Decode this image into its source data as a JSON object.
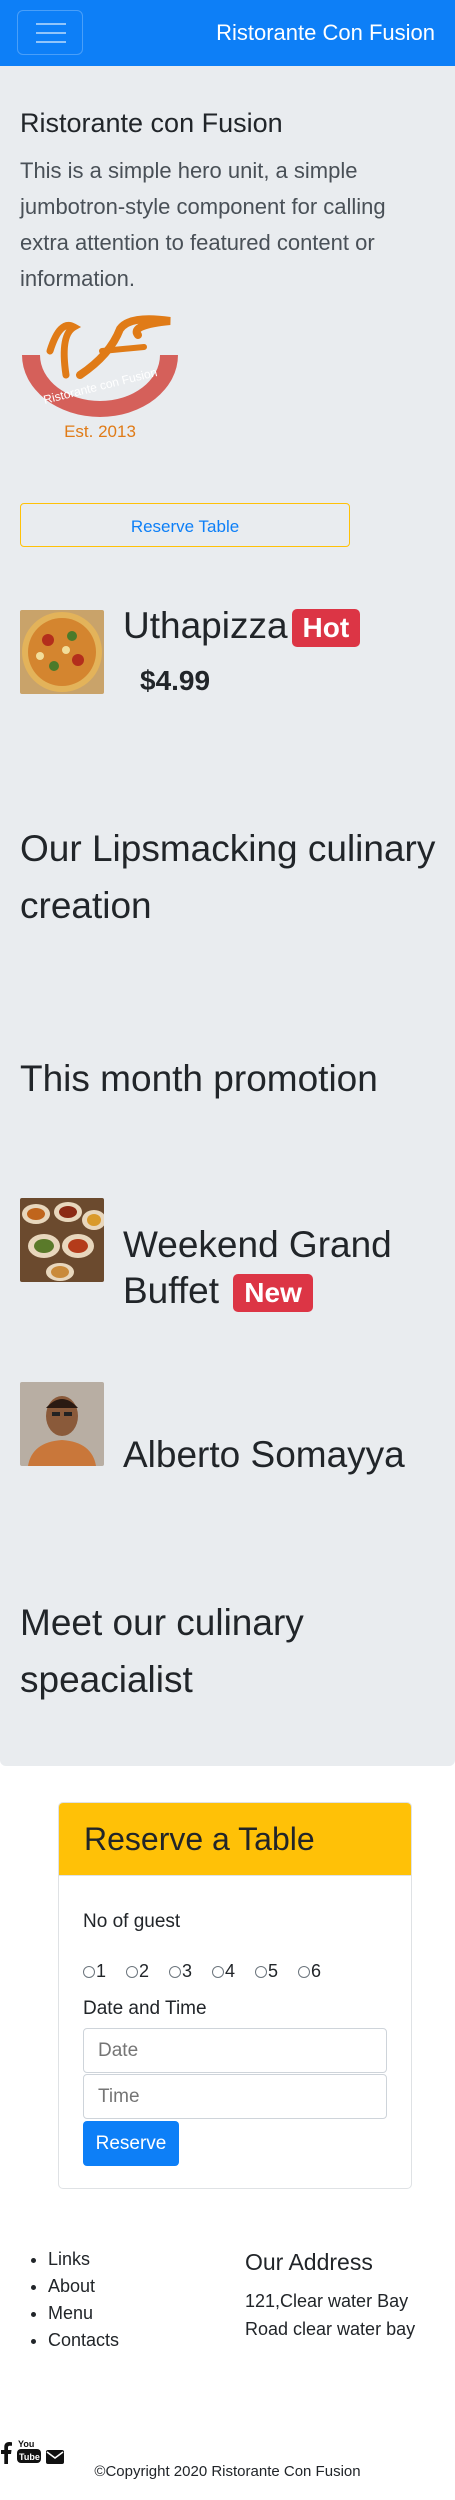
{
  "navbar": {
    "brand": "Ristorante Con Fusion",
    "toggle_label": "menu"
  },
  "hero": {
    "title": "Ristorante con Fusion",
    "text": "This is a simple hero unit, a simple jumbotron-style component for calling extra attention to featured content or information.",
    "logo": {
      "name": "Ristorante con Fusion",
      "est": "Est. 2013"
    },
    "reserve_button": "Reserve Table"
  },
  "dish": {
    "name": "Uthapizza",
    "badge": "Hot",
    "price": "$4.99",
    "description": "Our Lipsmacking culinary creation"
  },
  "promotion": {
    "heading": "This month promotion",
    "name": "Weekend Grand Buffet",
    "badge": "New"
  },
  "chef": {
    "name": "Alberto Somayya",
    "description": "Meet our culinary speacialist"
  },
  "reserve_form": {
    "title": "Reserve a Table",
    "guest_label": "No of guest",
    "guest_options": [
      "1",
      "2",
      "3",
      "4",
      "5",
      "6"
    ],
    "datetime_label": "Date and Time",
    "date_placeholder": "Date",
    "time_placeholder": "Time",
    "submit_label": "Reserve"
  },
  "footer": {
    "links": [
      "Links",
      "About",
      "Menu",
      "Contacts"
    ],
    "address_title": "Our Address",
    "address_text": "121,Clear water Bay Road clear water bay",
    "social_icons": [
      "facebook-icon",
      "youtube-icon",
      "envelope-icon"
    ],
    "copyright": "©Copyright 2020 Ristorante Con Fusion"
  },
  "colors": {
    "primary": "#0d7ff7",
    "warning": "#ffc107",
    "danger": "#dc3545",
    "jumbotron": "#e9ecef"
  }
}
